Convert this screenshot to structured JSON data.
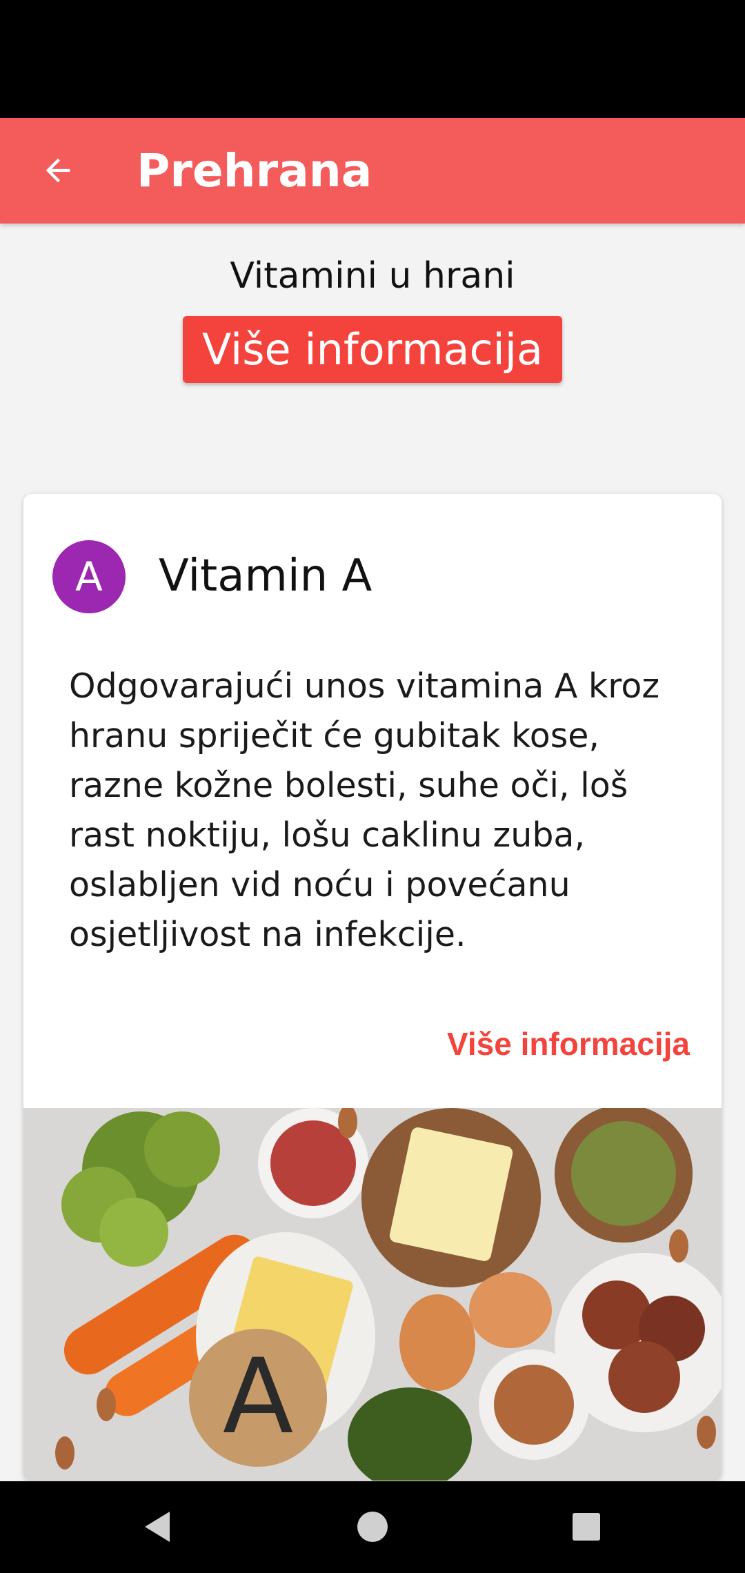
{
  "app_bar": {
    "title": "Prehrana",
    "back_icon": "arrow-left-icon",
    "color": "#f45b5b"
  },
  "header": {
    "subtitle": "Vitamini u hrani",
    "more_button_label": "Više informacija",
    "button_color": "#f4433c"
  },
  "card": {
    "avatar_letter": "A",
    "avatar_color": "#9c27b0",
    "title": "Vitamin A",
    "body": "Odgovarajući unos vitamina A kroz hranu spriječit će gubitak kose, razne kožne bolesti, suhe oči, loš rast noktiju, lošu caklinu zuba, oslabljen vid noću i povećanu osjetljivost na infekcije.",
    "link_label": "Više informacija",
    "image_tag_letter": "A"
  },
  "nav_bar": {
    "back_icon": "triangle-back-icon",
    "home_icon": "circle-home-icon",
    "recents_icon": "square-recents-icon"
  }
}
